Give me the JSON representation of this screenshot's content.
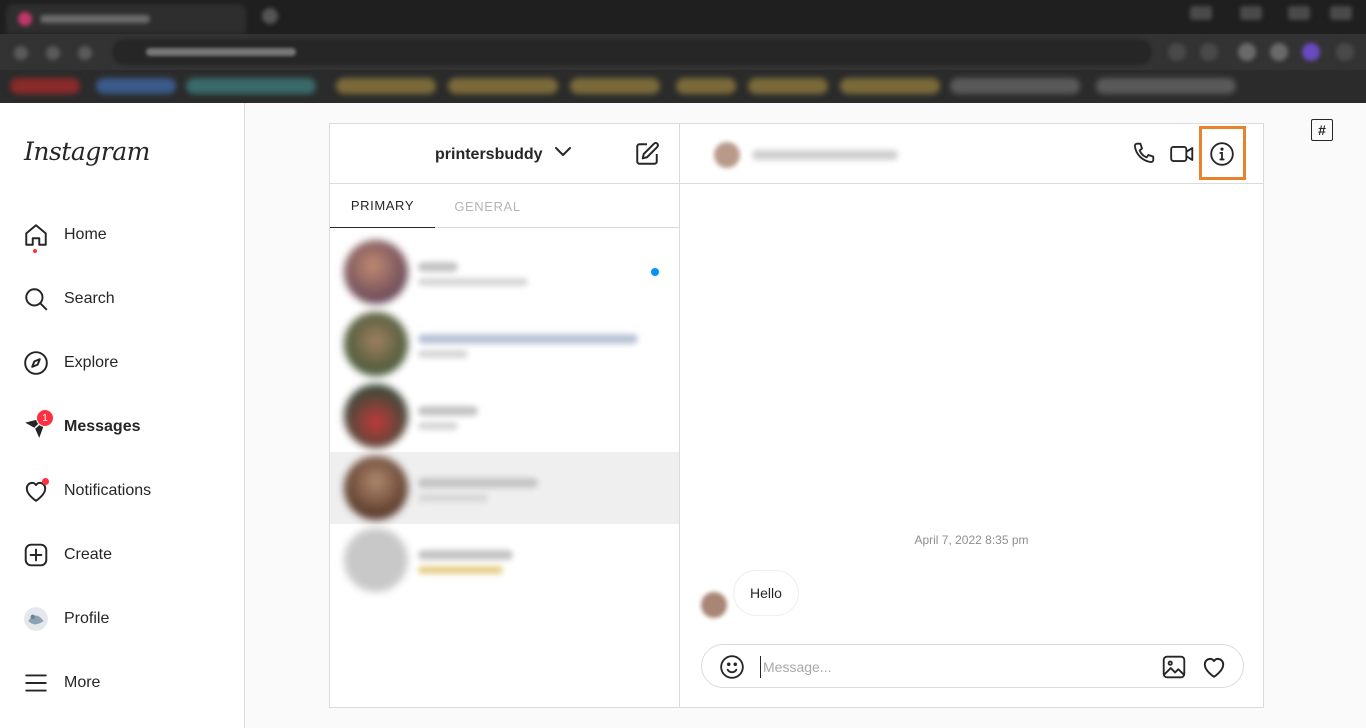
{
  "sidebar": {
    "logo": "Instagram",
    "items": [
      {
        "label": "Home",
        "icon": "home-icon"
      },
      {
        "label": "Search",
        "icon": "search-icon"
      },
      {
        "label": "Explore",
        "icon": "compass-icon"
      },
      {
        "label": "Messages",
        "icon": "messenger-icon",
        "badge": "1"
      },
      {
        "label": "Notifications",
        "icon": "heart-icon"
      },
      {
        "label": "Create",
        "icon": "plus-square-icon"
      },
      {
        "label": "Profile",
        "icon": "profile-avatar"
      },
      {
        "label": "More",
        "icon": "hamburger-icon"
      }
    ]
  },
  "inbox": {
    "account_name": "printersbuddy",
    "tabs": {
      "primary": "PRIMARY",
      "general": "GENERAL"
    },
    "threads_count_visible": 5
  },
  "conversation": {
    "timestamp": "April 7, 2022 8:35 pm",
    "messages": [
      {
        "text": "Hello",
        "from": "other"
      }
    ],
    "composer": {
      "placeholder": "Message..."
    }
  },
  "extension_badge": "#",
  "colors": {
    "highlight": "#e8822b",
    "notification": "#ff3040",
    "unread": "#0095f6"
  }
}
